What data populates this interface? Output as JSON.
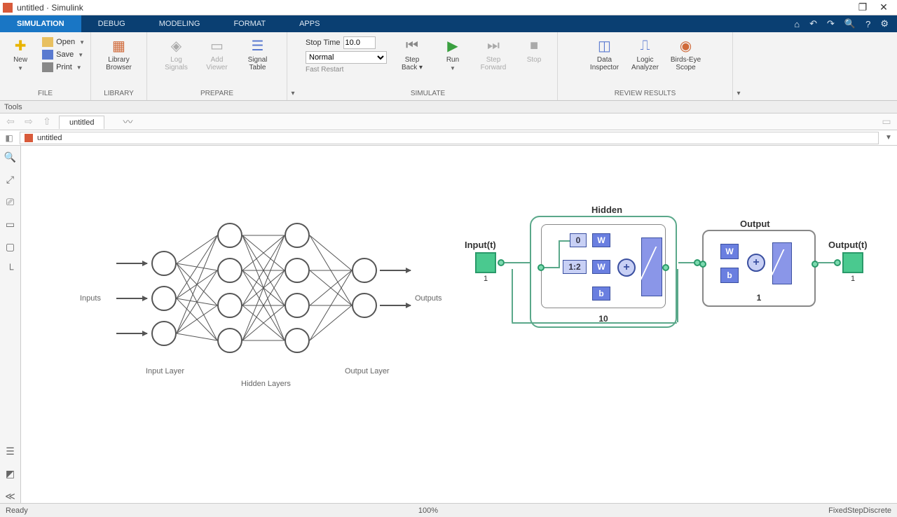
{
  "window": {
    "title": "untitled · Simulink"
  },
  "tabs": [
    "SIMULATION",
    "DEBUG",
    "MODELING",
    "FORMAT",
    "APPS"
  ],
  "active_tab": 0,
  "file": {
    "new": "New",
    "open": "Open",
    "save": "Save",
    "print": "Print",
    "group": "FILE"
  },
  "library": {
    "button": "Library\nBrowser",
    "group": "LIBRARY"
  },
  "prepare": {
    "log": "Log\nSignals",
    "add": "Add\nViewer",
    "table": "Signal\nTable",
    "group": "PREPARE"
  },
  "simulate": {
    "stoptime_label": "Stop Time",
    "stoptime_value": "10.0",
    "mode": "Normal",
    "restart": "Fast Restart",
    "back": "Step\nBack ▾",
    "run": "Run",
    "fwd": "Step\nForward",
    "stop": "Stop",
    "group": "SIMULATE"
  },
  "review": {
    "di": "Data\nInspector",
    "la": "Logic\nAnalyzer",
    "be": "Birds-Eye\nScope",
    "group": "REVIEW RESULTS"
  },
  "toolsbar": "Tools",
  "model_tab": "untitled",
  "breadcrumb": "untitled",
  "nn_labels": {
    "inputs": "Inputs",
    "outputs": "Outputs",
    "input_layer": "Input Layer",
    "hidden_layers": "Hidden Layers",
    "output_layer": "Output Layer"
  },
  "blocks": {
    "input_label": "Input(t)",
    "input_count": "1",
    "hidden_label": "Hidden",
    "hidden_count": "10",
    "output_label": "Output",
    "output_count": "1",
    "out_label": "Output(t)",
    "out_count": "1",
    "d0": "0",
    "d12": "1:2",
    "W": "W",
    "b": "b",
    "plus": "+"
  },
  "status": {
    "ready": "Ready",
    "zoom": "100%",
    "solver": "FixedStepDiscrete"
  }
}
